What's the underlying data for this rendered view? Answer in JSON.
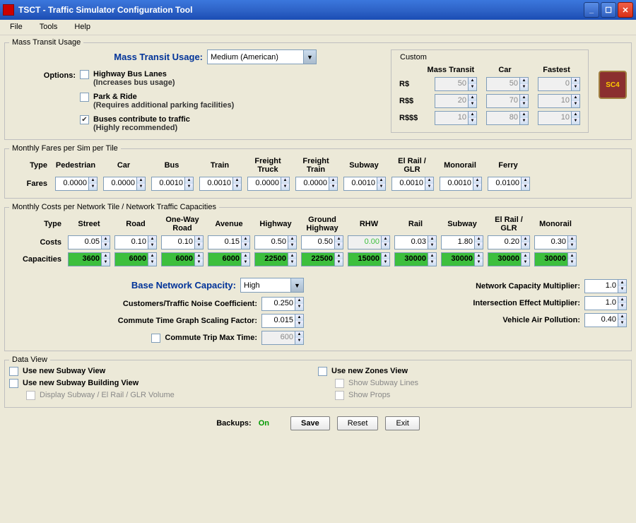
{
  "window": {
    "title": "TSCT - Traffic Simulator Configuration Tool"
  },
  "menu": {
    "file": "File",
    "tools": "Tools",
    "help": "Help"
  },
  "massTransit": {
    "legend": "Mass Transit Usage",
    "label": "Mass Transit Usage:",
    "selected": "Medium (American)",
    "optionsLabel": "Options:",
    "opt1": {
      "label": "Highway Bus Lanes",
      "sub": "(Increases bus usage)",
      "checked": false
    },
    "opt2": {
      "label": "Park & Ride",
      "sub": "(Requires additional parking facilities)",
      "checked": false
    },
    "opt3": {
      "label": "Buses contribute to traffic",
      "sub": "(Highly recommended)",
      "checked": true
    },
    "custom": {
      "title": "Custom",
      "hdr1": "Mass Transit",
      "hdr2": "Car",
      "hdr3": "Fastest",
      "row1": "R$",
      "row2": "R$$",
      "row3": "R$$$",
      "r1c1": "50",
      "r1c2": "50",
      "r1c3": "0",
      "r2c1": "20",
      "r2c2": "70",
      "r2c3": "10",
      "r3c1": "10",
      "r3c2": "80",
      "r3c3": "10"
    },
    "logo": "SC4"
  },
  "fares": {
    "legend": "Monthly Fares per Sim per Tile",
    "typeLabel": "Type",
    "faresLabel": "Fares",
    "cols": [
      "Pedestrian",
      "Car",
      "Bus",
      "Train",
      "Freight Truck",
      "Freight Train",
      "Subway",
      "El Rail / GLR",
      "Monorail",
      "Ferry"
    ],
    "vals": [
      "0.0000",
      "0.0000",
      "0.0010",
      "0.0010",
      "0.0000",
      "0.0000",
      "0.0010",
      "0.0010",
      "0.0010",
      "0.0100"
    ]
  },
  "network": {
    "legend": "Monthly Costs per Network Tile / Network Traffic Capacities",
    "typeLabel": "Type",
    "costsLabel": "Costs",
    "capLabel": "Capacities",
    "cols": [
      "Street",
      "Road",
      "One-Way Road",
      "Avenue",
      "Highway",
      "Ground Highway",
      "RHW",
      "Rail",
      "Subway",
      "El Rail / GLR",
      "Monorail"
    ],
    "costs": [
      "0.05",
      "0.10",
      "0.10",
      "0.15",
      "0.50",
      "0.50",
      "0.00",
      "0.03",
      "1.80",
      "0.20",
      "0.30"
    ],
    "caps": [
      "3600",
      "6000",
      "6000",
      "6000",
      "22500",
      "22500",
      "15000",
      "30000",
      "30000",
      "30000",
      "30000"
    ],
    "baseCapLabel": "Base Network Capacity:",
    "baseCapVal": "High",
    "noiseLabel": "Customers/Traffic Noise Coefficient:",
    "noiseVal": "0.250",
    "commuteLabel": "Commute Time Graph Scaling Factor:",
    "commuteVal": "0.015",
    "tripMaxLabel": "Commute Trip Max Time:",
    "tripMaxVal": "600",
    "capMultLabel": "Network Capacity Multiplier:",
    "capMultVal": "1.0",
    "intMultLabel": "Intersection Effect Multiplier:",
    "intMultVal": "1.0",
    "pollLabel": "Vehicle Air Pollution:",
    "pollVal": "0.40"
  },
  "dataView": {
    "legend": "Data View",
    "c1": "Use new Subway View",
    "c2": "Use new Subway Building View",
    "c2sub": "Display Subway / El Rail / GLR Volume",
    "c3": "Use new Zones View",
    "c3a": "Show Subway Lines",
    "c3b": "Show Props"
  },
  "bottom": {
    "backupsLabel": "Backups:",
    "backupsVal": "On",
    "save": "Save",
    "reset": "Reset",
    "exit": "Exit"
  }
}
